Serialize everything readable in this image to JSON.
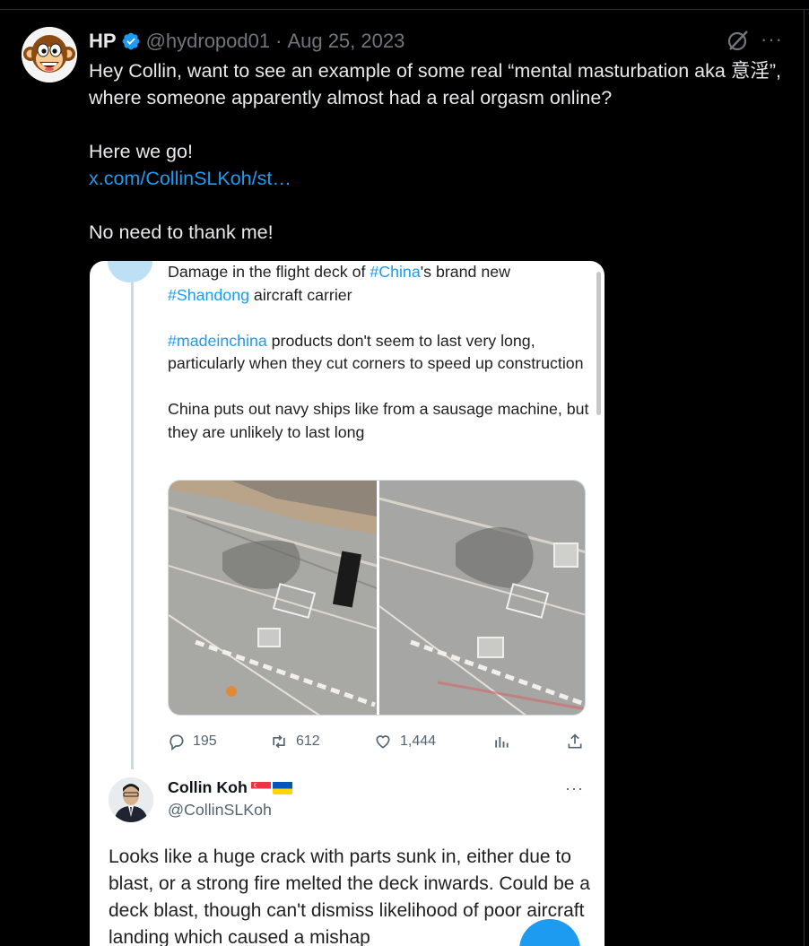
{
  "post": {
    "display_name": "HP",
    "handle": "@hydropod01",
    "separator": "·",
    "date": "Aug 25, 2023",
    "more_label": "···",
    "lines": [
      "Hey Collin, want to see an example of some real “mental masturbation aka 意淫”, where someone apparently almost had a real orgasm online?",
      "Here we go!",
      "x.com/CollinSLKoh/st…",
      "No need to thank me!"
    ]
  },
  "embedded": {
    "quoted_tweet": {
      "line1_pre": "Damage in the flight deck of ",
      "line1_tag": "#China",
      "line1_post": "'s brand new",
      "line2_tag": "#Shandong",
      "line2_post": " aircraft carrier",
      "para2_tag": "#madeinchina",
      "para2_text": " products don't seem to last very long, particularly when they cut corners to speed up construction",
      "para3_text": "China puts out navy ships like from a sausage machine, but they are unlikely to last long"
    },
    "actions": {
      "replies": "195",
      "reposts": "612",
      "likes": "1,444"
    },
    "reply": {
      "name": "Collin Koh",
      "handle": "@CollinSLKoh",
      "more_label": "···",
      "text": "Looks like a huge crack with parts sunk in, either due to blast, or a strong fire melted the deck inwards. Could be a deck blast, though can't dismiss likelihood of poor aircraft landing which caused a mishap"
    }
  },
  "colors": {
    "background": "#000000",
    "text": "#e7e9ea",
    "muted": "#71767b",
    "link": "#1d9bf0",
    "verified": "#1d9bf0"
  }
}
